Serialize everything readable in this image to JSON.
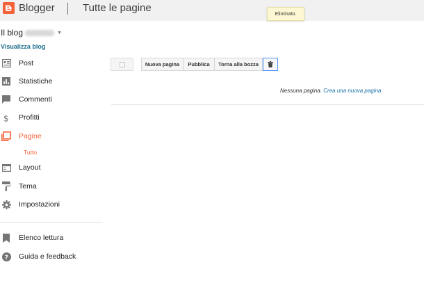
{
  "header": {
    "brand": "Blogger",
    "page_title": "Tutte le pagine"
  },
  "toast": {
    "text": "Eliminato."
  },
  "blog": {
    "name_prefix": "Il blog",
    "view_link": "Visualizza blog"
  },
  "sidebar": {
    "items": [
      {
        "label": "Post",
        "icon": "posts-icon"
      },
      {
        "label": "Statistiche",
        "icon": "stats-icon"
      },
      {
        "label": "Commenti",
        "icon": "comments-icon"
      },
      {
        "label": "Profitti",
        "icon": "dollar-icon"
      },
      {
        "label": "Pagine",
        "icon": "pages-icon",
        "active": true
      },
      {
        "label": "Layout",
        "icon": "layout-icon"
      },
      {
        "label": "Tema",
        "icon": "theme-roller-icon"
      },
      {
        "label": "Impostazioni",
        "icon": "gear-icon"
      }
    ],
    "sub_item": "Tutto",
    "footer_items": [
      {
        "label": "Elenco lettura",
        "icon": "bookmark-icon"
      },
      {
        "label": "Guida e feedback",
        "icon": "help-icon"
      }
    ]
  },
  "toolbar": {
    "new_page": "Nuova pagina",
    "publish": "Pubblica",
    "revert_draft": "Torna alla bozza",
    "trash_icon": "trash-icon"
  },
  "content": {
    "empty_text": "Nessuna pagina.",
    "create_link": "Crea una nuova pagina"
  },
  "colors": {
    "accent": "#f4623a",
    "link": "#1e6f8e",
    "toast_bg": "#fdf8d3"
  }
}
